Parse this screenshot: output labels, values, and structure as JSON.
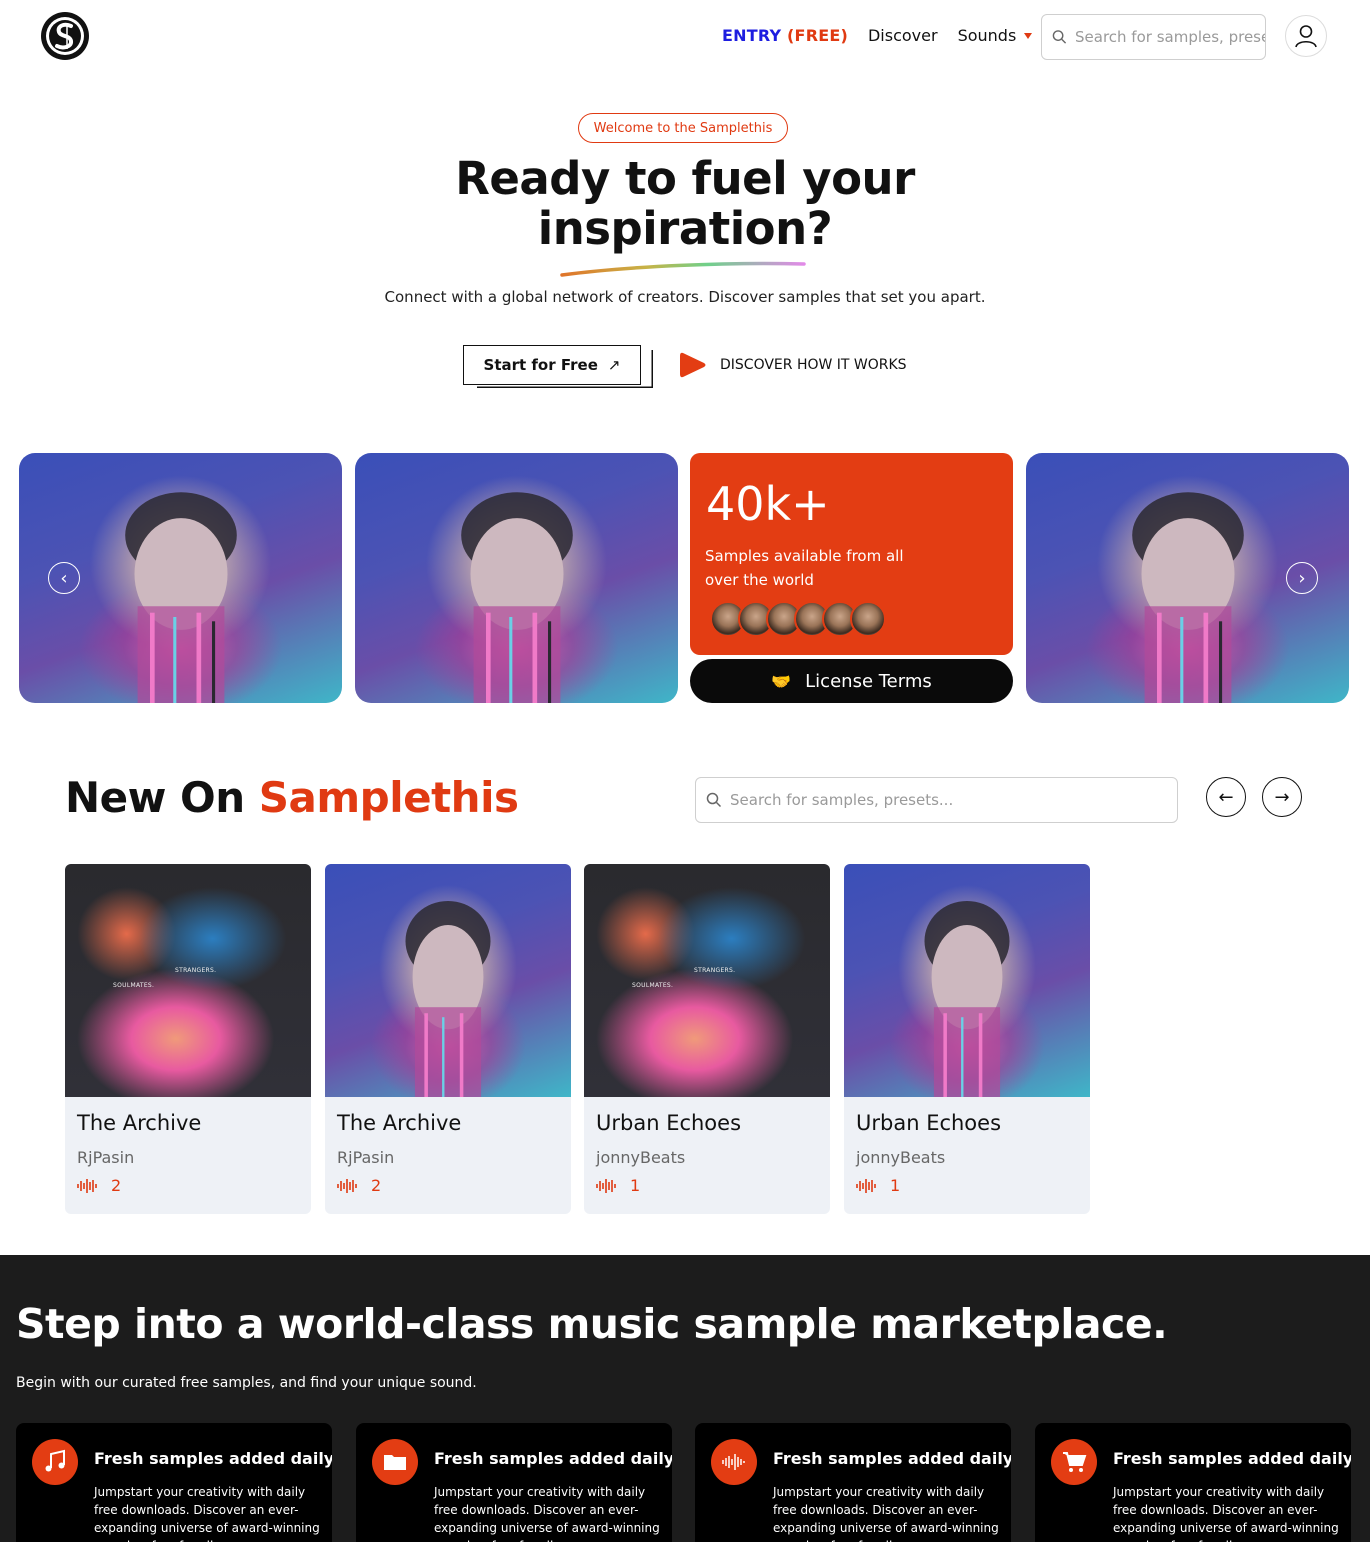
{
  "header": {
    "nav": {
      "entry_label": "ENTRY",
      "entry_free": "(FREE)",
      "discover": "Discover",
      "sounds": "Sounds"
    },
    "search_placeholder": "Search for samples, presets..."
  },
  "hero": {
    "badge": "Welcome to the Samplethis",
    "title_line1": "Ready to fuel your",
    "title_line2": "inspiration?",
    "subtitle": "Connect with a global network of creators. Discover samples that set you apart.",
    "start_button": "Start for Free",
    "discover_button": "DISCOVER HOW IT WORKS"
  },
  "carousel": {
    "stat_value": "40k+",
    "stat_text": "Samples available from all over the world",
    "license_button": "License Terms",
    "avatar_count": 6
  },
  "new_section": {
    "title_part1": "New On",
    "title_part2": "Samplethis",
    "search_placeholder": "Search for samples, presets...",
    "cards": [
      {
        "title": "The Archive",
        "author": "RjPasin",
        "count": "2",
        "art": "soulmates",
        "art_text_1": "SOULMATES.",
        "art_text_2": "STRANGERS."
      },
      {
        "title": "The Archive",
        "author": "RjPasin",
        "count": "2",
        "art": "statue"
      },
      {
        "title": "Urban Echoes",
        "author": "jonnyBeats",
        "count": "1",
        "art": "soulmates",
        "art_text_1": "SOULMATES.",
        "art_text_2": "STRANGERS."
      },
      {
        "title": "Urban Echoes",
        "author": "jonnyBeats",
        "count": "1",
        "art": "statue"
      }
    ]
  },
  "marketplace": {
    "title": "Step into a world-class music sample marketplace.",
    "subtitle": "Begin with our curated free samples, and find your unique sound.",
    "features": [
      {
        "icon": "music-note-icon",
        "title": "Fresh samples added daily",
        "text": "Jumpstart your creativity with daily free downloads. Discover an ever-expanding universe of award-winning samples, free for all."
      },
      {
        "icon": "folder-icon",
        "title": "Fresh samples added daily",
        "text": "Jumpstart your creativity with daily free downloads. Discover an ever-expanding universe of award-winning samples, free for all."
      },
      {
        "icon": "waveform-icon",
        "title": "Fresh samples added daily",
        "text": "Jumpstart your creativity with daily free downloads. Discover an ever-expanding universe of award-winning samples, free for all."
      },
      {
        "icon": "shopping-cart-icon",
        "title": "Fresh samples added daily",
        "text": "Jumpstart your creativity with daily free downloads. Discover an ever-expanding universe of award-winning samples, free for all."
      }
    ]
  },
  "colors": {
    "accent": "#e33d13",
    "nav_entry": "#1d1de0",
    "dark_bg": "#1c1c1c",
    "card_bg": "#eef1f6"
  }
}
